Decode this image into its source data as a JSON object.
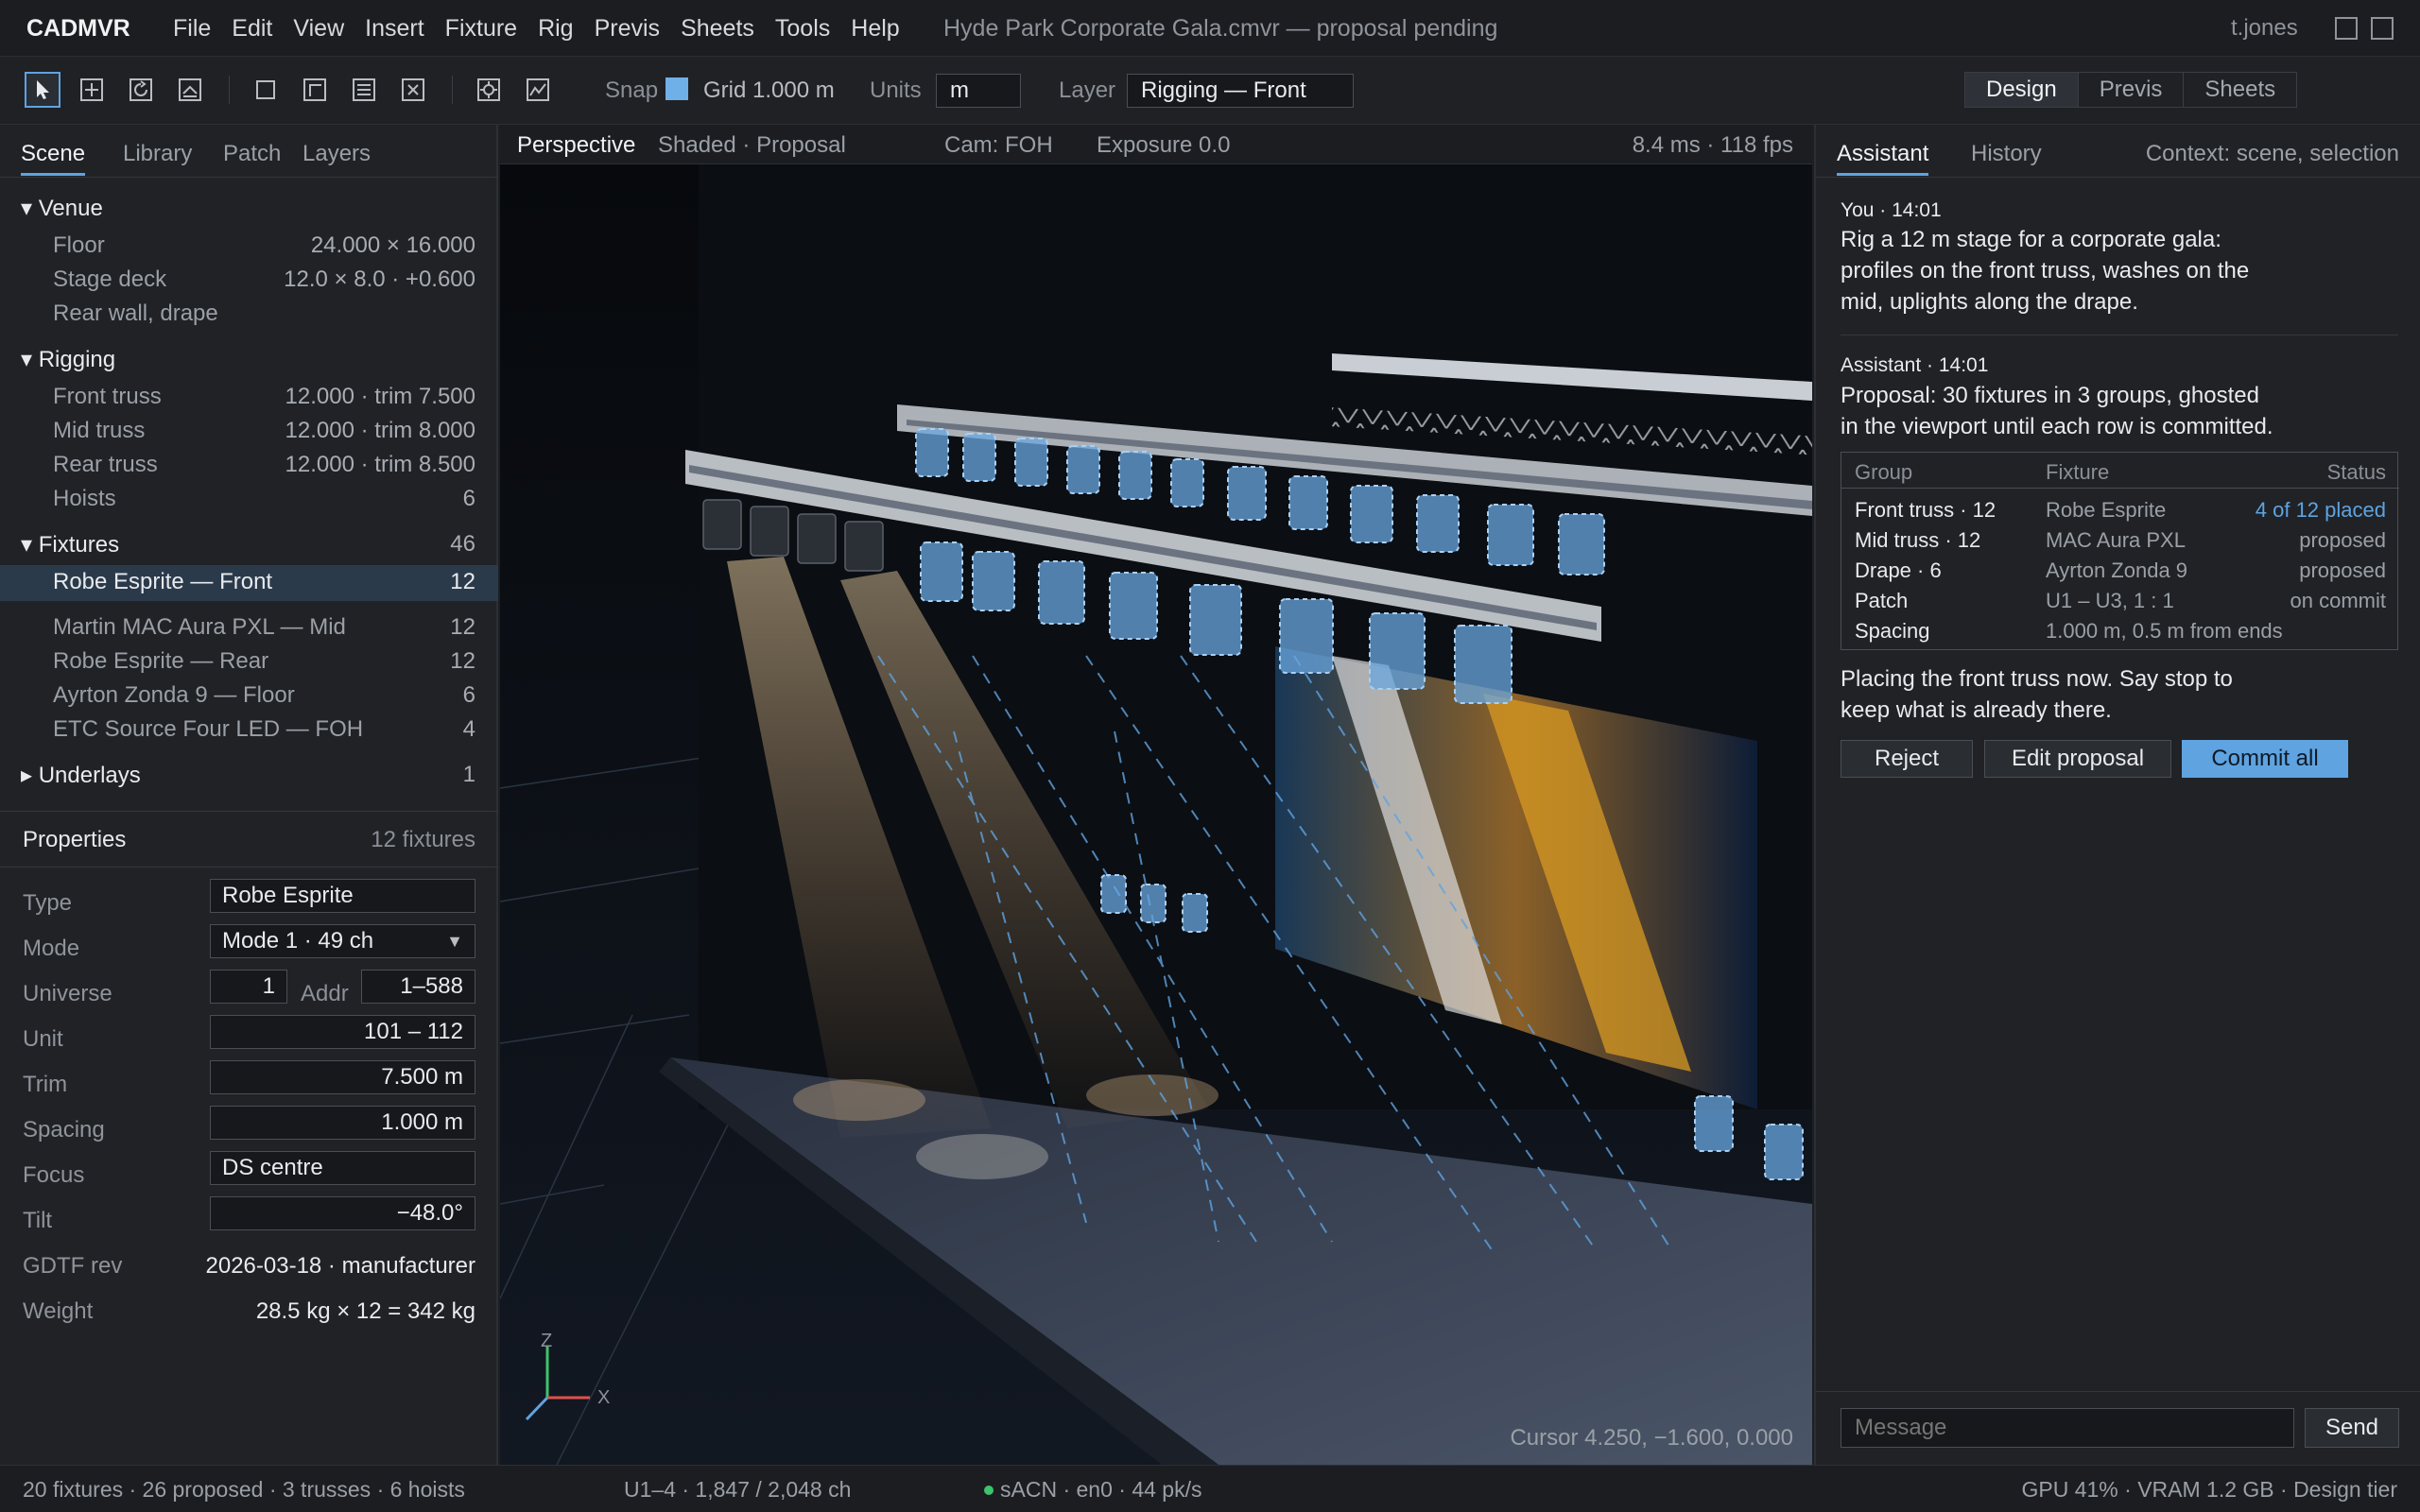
{
  "app": {
    "brand": "CADMVR",
    "menus": [
      "File",
      "Edit",
      "View",
      "Insert",
      "Fixture",
      "Rig",
      "Previs",
      "Sheets",
      "Tools",
      "Help"
    ],
    "document_title": "Hyde Park Corporate Gala.cmvr — proposal pending",
    "user": "t.jones"
  },
  "toolbar": {
    "snap_label": "Snap",
    "grid_label": "Grid 1.000 m",
    "units_label": "Units",
    "units_value": "m",
    "layer_label": "Layer",
    "layer_value": "Rigging — Front",
    "modes": [
      "Design",
      "Previs",
      "Sheets"
    ],
    "active_mode": "Design",
    "accent": "#5fa3e0"
  },
  "left": {
    "tabs": [
      "Scene",
      "Library",
      "Patch",
      "Layers"
    ],
    "tree": [
      {
        "label": "▾ Venue",
        "value": "",
        "kind": "group"
      },
      {
        "label": "Floor",
        "value": "24.000 × 16.000",
        "kind": "item"
      },
      {
        "label": "Stage deck",
        "value": "12.0 × 8.0 · +0.600",
        "kind": "item"
      },
      {
        "label": "Rear wall, drape",
        "value": "",
        "kind": "item"
      },
      {
        "label": "▾ Rigging",
        "value": "",
        "kind": "group"
      },
      {
        "label": "Front truss",
        "value": "12.000 · trim 7.500",
        "kind": "item"
      },
      {
        "label": "Mid truss",
        "value": "12.000 · trim 8.000",
        "kind": "item"
      },
      {
        "label": "Rear truss",
        "value": "12.000 · trim 8.500",
        "kind": "item"
      },
      {
        "label": "Hoists",
        "value": "6",
        "kind": "item"
      },
      {
        "label": "▾ Fixtures",
        "value": "46",
        "kind": "group"
      },
      {
        "label": "Robe Esprite — Front",
        "value": "12",
        "kind": "selected"
      },
      {
        "label": "Martin MAC Aura PXL — Mid",
        "value": "12",
        "kind": "item"
      },
      {
        "label": "Robe Esprite — Rear",
        "value": "12",
        "kind": "item"
      },
      {
        "label": "Ayrton Zonda 9 — Floor",
        "value": "6",
        "kind": "item"
      },
      {
        "label": "ETC Source Four LED — FOH",
        "value": "4",
        "kind": "item"
      },
      {
        "label": "▸ Underlays",
        "value": "1",
        "kind": "group"
      }
    ],
    "properties": {
      "title": "Properties",
      "count": "12 fixtures",
      "type_label": "Type",
      "type": "Robe Esprite",
      "mode_label": "Mode",
      "mode": "Mode 1 · 49 ch",
      "universe_label": "Universe",
      "universe": "1",
      "addr_label": "Addr",
      "addr": "1–588",
      "unit_label": "Unit",
      "unit": "101 – 112",
      "trim_label": "Trim",
      "trim": "7.500 m",
      "spacing_label": "Spacing",
      "spacing": "1.000 m",
      "focus_label": "Focus",
      "focus": "DS centre",
      "tilt_label": "Tilt",
      "tilt": "−48.0°",
      "gdtf_label": "GDTF rev",
      "gdtf": "2026-03-18 · manufacturer",
      "weight_label": "Weight",
      "weight": "28.5 kg × 12 = 342 kg"
    }
  },
  "viewport": {
    "view": "Perspective",
    "shading": "Shaded · Proposal",
    "camera": "Cam: FOH",
    "exposure": "Exposure 0.0",
    "perf": "8.4 ms · 118 fps",
    "cursor": "Cursor 4.250, −1.600, 0.000",
    "axis_z": "Z",
    "axis_x": "X"
  },
  "assistant": {
    "tabs": [
      "Assistant",
      "History"
    ],
    "context": "Context: scene, selection",
    "user_meta": "You · 14:01",
    "user_lines": [
      "Rig a 12 m stage for a corporate gala:",
      "profiles on the front truss, washes on the",
      "mid, uplights along the drape."
    ],
    "assistant_meta": "Assistant · 14:01",
    "assistant_lines": [
      "Proposal: 30 fixtures in 3 groups, ghosted",
      "in the viewport until each row is committed."
    ],
    "table_headers": [
      "Group",
      "Fixture",
      "Status"
    ],
    "table_rows": [
      {
        "group": "Front truss · 12",
        "fixture": "Robe Esprite",
        "status": "4 of 12 placed"
      },
      {
        "group": "Mid truss · 12",
        "fixture": "MAC Aura PXL",
        "status": "proposed"
      },
      {
        "group": "Drape · 6",
        "fixture": "Ayrton Zonda 9",
        "status": "proposed"
      },
      {
        "group": "Patch",
        "fixture": "U1 – U3, 1 : 1",
        "status": "on commit"
      },
      {
        "group": "Spacing",
        "fixture": "1.000 m, 0.5 m from ends",
        "status": ""
      }
    ],
    "placing_lines": [
      "Placing the front truss now. Say stop to",
      "keep what is already there."
    ],
    "reject": "Reject",
    "edit": "Edit proposal",
    "commit": "Commit all",
    "message_placeholder": "Message",
    "send": "Send"
  },
  "status": {
    "left": "20 fixtures · 26 proposed · 3 trusses · 6 hoists",
    "universes": "U1–4 · 1,847 / 2,048 ch",
    "network": "sACN · en0 · 44 pk/s",
    "network_dot_color": "#3cc46b",
    "right": "GPU 41% · VRAM 1.2 GB · Design tier"
  }
}
